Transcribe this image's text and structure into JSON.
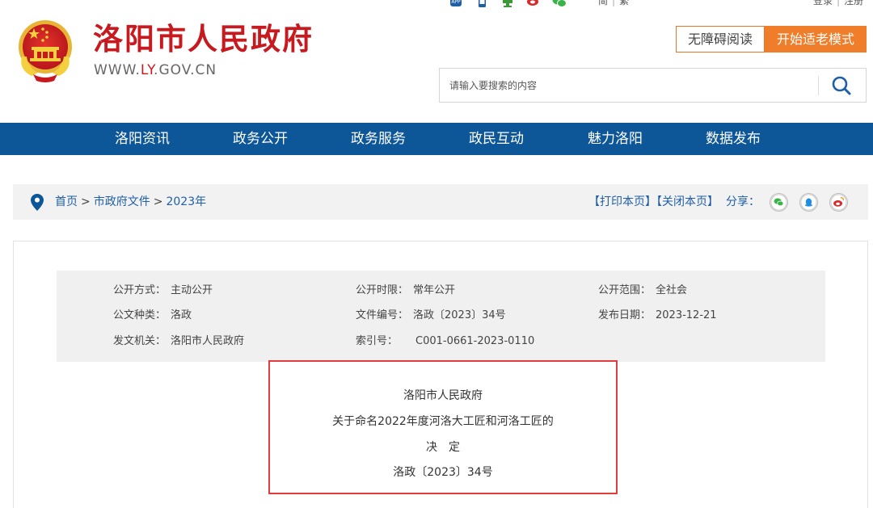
{
  "header": {
    "site_title": "洛阳市人民政府",
    "domain_prefix": "WWW.",
    "domain_highlight": "LY",
    "domain_suffix": ".GOV.CN",
    "top_icons": [
      "app-icon",
      "mobile-icon",
      "wechat-mini-icon",
      "weibo-icon",
      "wechat-icon"
    ],
    "lang": {
      "simplified": "简",
      "traditional": "繁"
    },
    "auth": {
      "login": "登录",
      "register": "注册"
    },
    "accessible_button": "无障碍阅读",
    "elder_mode_button": "开始适老模式",
    "search": {
      "placeholder": "请输入要搜索的内容",
      "icon": "search-icon"
    },
    "colors": {
      "brand_red": "#c8191f",
      "accent_orange": "#f07d2a"
    }
  },
  "nav": {
    "color": "#0d5697",
    "items": [
      {
        "label": "洛阳资讯"
      },
      {
        "label": "政务公开"
      },
      {
        "label": "政务服务"
      },
      {
        "label": "政民互动"
      },
      {
        "label": "魅力洛阳"
      },
      {
        "label": "数据发布"
      }
    ]
  },
  "breadcrumb": {
    "items": [
      "首页",
      "市政府文件",
      "2023年"
    ],
    "separator": ">",
    "print": "【打印本页】",
    "close": "【关闭本页】",
    "share_label": "分享：",
    "share_icons": [
      "wechat-icon",
      "qq-icon",
      "weibo-icon"
    ]
  },
  "meta": {
    "row1": [
      {
        "key": "公开方式：",
        "value": "主动公开"
      },
      {
        "key": "公开时限：",
        "value": "常年公开"
      },
      {
        "key": "公开范围：",
        "value": "全社会"
      }
    ],
    "row2": [
      {
        "key": "公文种类：",
        "value": "洛政"
      },
      {
        "key": "文件编号：",
        "value": "洛政〔2023〕34号"
      },
      {
        "key": "发布日期：",
        "value": "2023-12-21"
      }
    ],
    "row3": [
      {
        "key": "发文机关：",
        "value": "洛阳市人民政府"
      },
      {
        "key": "索引号：",
        "value": "C001-0661-2023-0110"
      }
    ]
  },
  "document": {
    "issuer": "洛阳市人民政府",
    "title": "关于命名2022年度河洛大工匠和河洛工匠的",
    "doc_type": "决　定",
    "number": "洛政〔2023〕34号"
  }
}
